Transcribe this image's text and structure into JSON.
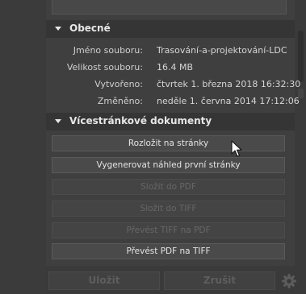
{
  "sections": {
    "general": {
      "title": "Obecné",
      "rows": [
        {
          "label": "Jméno souboru:",
          "value": "Trasování-a-projektování-LDC"
        },
        {
          "label": "Velikost souboru:",
          "value": "16.4 MB"
        },
        {
          "label": "Vytvořeno:",
          "value": "čtvrtek 1. března 2018 16:32:30"
        },
        {
          "label": "Změněno:",
          "value": "neděle 1. června 2014 17:12:06"
        }
      ]
    },
    "multipage": {
      "title": "Vícestránkové dokumenty",
      "buttons": [
        {
          "label": "Rozložit na stránky",
          "enabled": true
        },
        {
          "label": "Vygenerovat náhled první stránky",
          "enabled": true
        },
        {
          "label": "Složit do PDF",
          "enabled": false
        },
        {
          "label": "Složit do TIFF",
          "enabled": false
        },
        {
          "label": "Převést TIFF na PDF",
          "enabled": false
        },
        {
          "label": "Převést PDF na TIFF",
          "enabled": true
        }
      ]
    }
  },
  "footer": {
    "save_label": "Uložit",
    "cancel_label": "Zrušit",
    "settings_icon": "gear-icon"
  }
}
